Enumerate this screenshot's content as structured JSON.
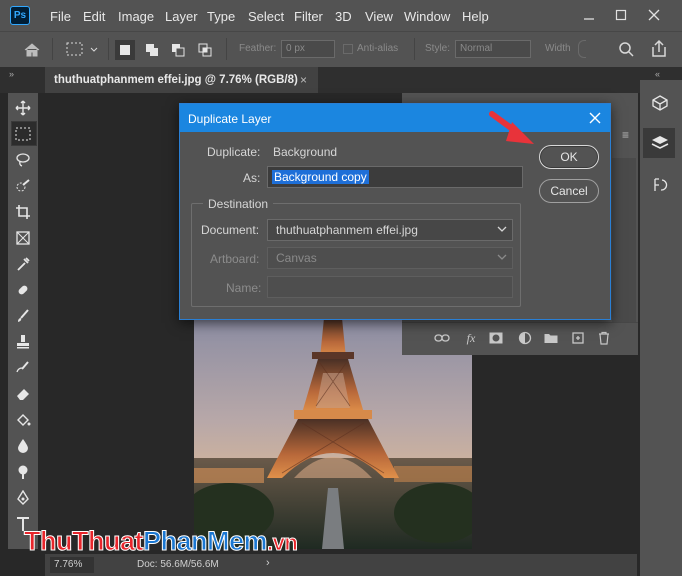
{
  "app": {
    "logo": "Ps"
  },
  "menu": [
    "File",
    "Edit",
    "Image",
    "Layer",
    "Type",
    "Select",
    "Filter",
    "3D",
    "View",
    "Window",
    "Help"
  ],
  "window_controls": [
    "minimize-icon",
    "maximize-icon",
    "close-icon"
  ],
  "options_bar": {
    "feather_label": "Feather:",
    "feather_value": "0 px",
    "antialias_label": "Anti-alias",
    "style_label": "Style:",
    "style_value": "Normal",
    "width_label": "Width"
  },
  "document_tab": {
    "title": "thuthuatphanmem effei.jpg @ 7.76% (RGB/8)",
    "close": "×"
  },
  "status_bar": {
    "zoom": "7.76%",
    "doc_info": "Doc: 56.6M/56.6M",
    "arrow": "›"
  },
  "dialog": {
    "title": "Duplicate Layer",
    "duplicate_label": "Duplicate:",
    "duplicate_value": "Background",
    "as_label": "As:",
    "as_value": "Background copy",
    "destination_legend": "Destination",
    "document_label": "Document:",
    "document_value": "thuthuatphanmem effei.jpg",
    "artboard_label": "Artboard:",
    "artboard_value": "Canvas",
    "name_label": "Name:",
    "name_value": "",
    "ok_label": "OK",
    "cancel_label": "Cancel"
  },
  "layers_footer_icons": [
    "link-icon",
    "fx-icon",
    "mask-icon",
    "adjustment-icon",
    "folder-icon",
    "new-layer-icon",
    "trash-icon"
  ],
  "watermark": {
    "part1": "Thu",
    "part2": "Thuat",
    "part3": "Phan",
    "part4": "Mem",
    "part5": ".vn"
  },
  "colors": {
    "accent": "#1b86e0",
    "selection": "#1e6fd8",
    "annotation_arrow": "#e8333a",
    "watermark_red": "#e8252b",
    "watermark_blue": "#1a77d2"
  }
}
